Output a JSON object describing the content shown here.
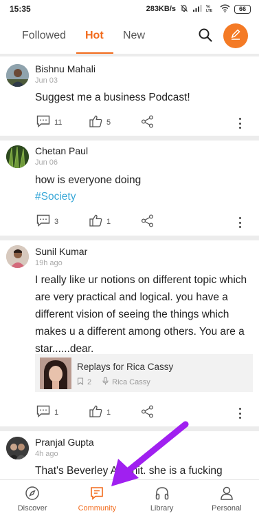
{
  "status_bar": {
    "time": "15:35",
    "network_speed": "283KB/s",
    "battery": "66"
  },
  "tabs": [
    {
      "label": "Followed"
    },
    {
      "label": "Hot"
    },
    {
      "label": "New"
    }
  ],
  "posts": [
    {
      "author": "Bishnu Mahali",
      "time": "Jun 03",
      "text": "Suggest me a business Podcast!",
      "comments": "11",
      "likes": "5"
    },
    {
      "author": "Chetan Paul",
      "time": "Jun 06",
      "text": "how is everyone doing",
      "hashtag": "#Society",
      "comments": "3",
      "likes": "1"
    },
    {
      "author": "Sunil Kumar",
      "time": "19h ago",
      "text": "I really like ur notions  on different topic  which are very practical and logical. you have a different vision of seeing the things which makes u a different among others. You are a star......dear.",
      "replay": {
        "title": "Replays for Rica Cassy",
        "count": "2",
        "host": "Rica Cassy"
      },
      "comments": "1",
      "likes": "1"
    },
    {
      "author": "Pranjal Gupta",
      "time": "4h ago",
      "text": "That's Beverley Al... nit. she is a fucking"
    }
  ],
  "bottom_nav": [
    {
      "label": "Discover",
      "icon": "compass-icon"
    },
    {
      "label": "Community",
      "icon": "chat-icon"
    },
    {
      "label": "Library",
      "icon": "headphones-icon"
    },
    {
      "label": "Personal",
      "icon": "person-icon"
    }
  ],
  "colors": {
    "accent": "#f26a1b",
    "hashtag": "#3aa8d8",
    "annotation_arrow": "#a020f0"
  }
}
